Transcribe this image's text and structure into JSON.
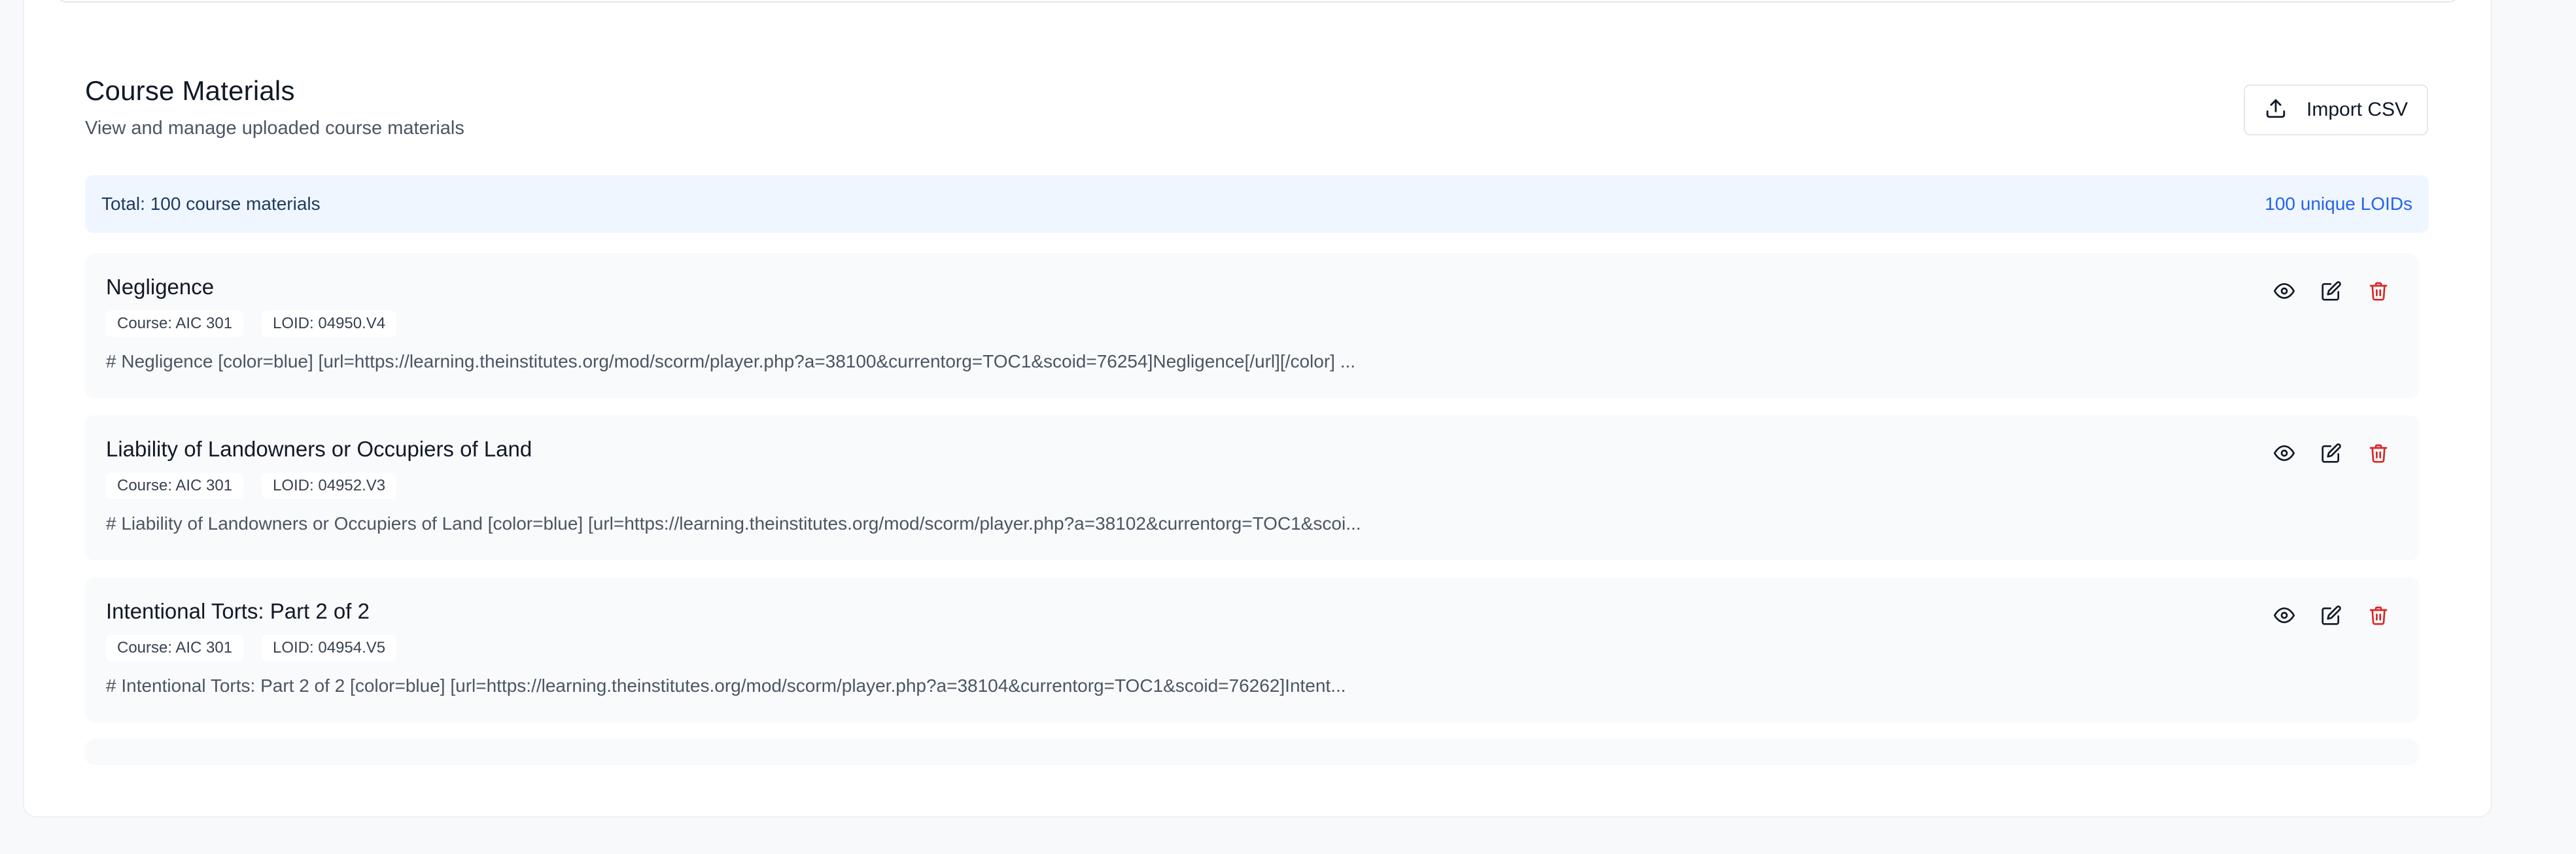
{
  "section": {
    "title": "Course Materials",
    "subtitle": "View and manage uploaded course materials",
    "import_label": "Import CSV"
  },
  "summary": {
    "total": "Total: 100 course materials",
    "unique": "100 unique LOIDs"
  },
  "items": [
    {
      "title": "Negligence",
      "course": "Course: AIC 301",
      "loid": "LOID: 04950.V4",
      "desc": "# Negligence [color=blue] [url=https://learning.theinstitutes.org/mod/scorm/player.php?a=38100&currentorg=TOC1&scoid=76254]Negligence[/url][/color] ..."
    },
    {
      "title": "Liability of Landowners or Occupiers of Land",
      "course": "Course: AIC 301",
      "loid": "LOID: 04952.V3",
      "desc": "# Liability of Landowners or Occupiers of Land [color=blue] [url=https://learning.theinstitutes.org/mod/scorm/player.php?a=38102&currentorg=TOC1&scoi..."
    },
    {
      "title": "Intentional Torts: Part 2 of 2",
      "course": "Course: AIC 301",
      "loid": "LOID: 04954.V5",
      "desc": "# Intentional Torts: Part 2 of 2 [color=blue] [url=https://learning.theinstitutes.org/mod/scorm/player.php?a=38104&currentorg=TOC1&scoid=76262]Intent..."
    }
  ],
  "icons": {
    "view": "eye-icon",
    "edit": "edit-icon",
    "delete": "trash-icon",
    "import": "upload-icon"
  },
  "colors": {
    "delete": "#dc2626",
    "summary_bg": "#eff6ff",
    "summary_total": "#1e3a5f",
    "summary_unique": "#2563eb"
  }
}
